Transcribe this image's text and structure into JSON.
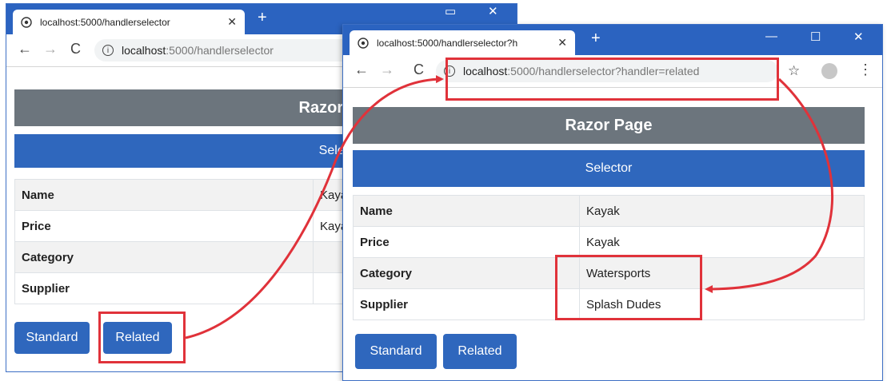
{
  "colors": {
    "tabstrip": "#2b63c0",
    "header_dark": "#6c757d",
    "header_blue": "#2f67bd",
    "button": "#2f67bd",
    "highlight": "#e0323a"
  },
  "back_window": {
    "tab_title": "localhost:5000/handlerselector",
    "tab_close": "✕",
    "new_tab": "+",
    "url_host": "localhost",
    "url_path": ":5000/handlerselector",
    "page_title": "Razor Page",
    "selector_label": "Selector",
    "rows": [
      {
        "key": "Name",
        "value": "Kayak"
      },
      {
        "key": "Price",
        "value": "Kayak"
      },
      {
        "key": "Category",
        "value": ""
      },
      {
        "key": "Supplier",
        "value": ""
      }
    ],
    "standard_label": "Standard",
    "related_label": "Related"
  },
  "front_window": {
    "tab_title": "localhost:5000/handlerselector?h",
    "tab_close": "✕",
    "new_tab": "+",
    "minimize": "—",
    "maximize": "☐",
    "close": "✕",
    "url_host": "localhost",
    "url_path": ":5000/handlerselector?handler=related",
    "page_title": "Razor Page",
    "selector_label": "Selector",
    "rows": [
      {
        "key": "Name",
        "value": "Kayak"
      },
      {
        "key": "Price",
        "value": "Kayak"
      },
      {
        "key": "Category",
        "value": "Watersports"
      },
      {
        "key": "Supplier",
        "value": "Splash Dudes"
      }
    ],
    "standard_label": "Standard",
    "related_label": "Related"
  },
  "icons": {
    "back": "back-arrow-icon",
    "forward": "forward-arrow-icon",
    "reload": "reload-icon",
    "info": "info-icon",
    "star": "star-icon",
    "profile": "profile-icon",
    "menu": "menu-dots-icon"
  }
}
